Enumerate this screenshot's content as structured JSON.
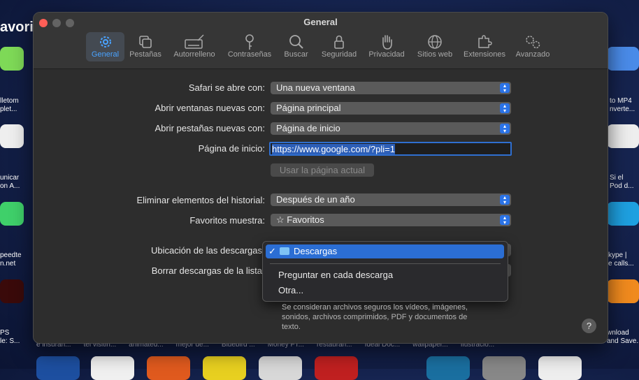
{
  "window": {
    "title": "General"
  },
  "tabs": [
    {
      "label": "General",
      "icon": "gear-icon"
    },
    {
      "label": "Pestañas",
      "icon": "tabs-icon"
    },
    {
      "label": "Autorrelleno",
      "icon": "pencil-keyboard-icon"
    },
    {
      "label": "Contraseñas",
      "icon": "key-icon"
    },
    {
      "label": "Buscar",
      "icon": "magnifier-icon"
    },
    {
      "label": "Seguridad",
      "icon": "lock-icon"
    },
    {
      "label": "Privacidad",
      "icon": "hand-icon"
    },
    {
      "label": "Sitios web",
      "icon": "globe-icon"
    },
    {
      "label": "Extensiones",
      "icon": "puzzle-icon"
    },
    {
      "label": "Avanzado",
      "icon": "gears-icon"
    }
  ],
  "settings": {
    "safari_opens_label": "Safari se abre con:",
    "safari_opens_value": "Una nueva ventana",
    "new_windows_label": "Abrir ventanas nuevas con:",
    "new_windows_value": "Página principal",
    "new_tabs_label": "Abrir pestañas nuevas con:",
    "new_tabs_value": "Página de inicio",
    "homepage_label": "Página de inicio:",
    "homepage_value": "https://www.google.com/?pli=1",
    "use_current_button": "Usar la página actual",
    "history_label": "Eliminar elementos del historial:",
    "history_value": "Después de un año",
    "favorites_label": "Favoritos muestra:",
    "favorites_value": "☆ Favoritos",
    "downloads_location_label": "Ubicación de las descargas",
    "clear_downloads_label": "Borrar descargas de la lista",
    "safe_files_note": "Se consideran archivos seguros los vídeos, imágenes, sonidos, archivos comprimidos, PDF y documentos de texto."
  },
  "downloads_menu": {
    "checkmark": "✓",
    "selected": "Descargas",
    "options": [
      "Preguntar en cada descarga",
      "Otra..."
    ]
  },
  "help": "?",
  "background": {
    "title_fragment": "avorito",
    "left_items": [
      "lletom\nplet...",
      "unicar\non A...",
      "peedte\nn.net",
      "PS\nle: S..."
    ],
    "right_items": [
      "to MP4\nnverte...",
      "Si el\nPod d...",
      "kype |\ne calls...",
      "wnload\nand Save..."
    ],
    "bottom_items": [
      "e insuran...",
      "tel visitin...",
      "animated...",
      "mejor de...",
      "Bluebird ...",
      "Money FT...",
      "restauran...",
      "Ideal Doc...",
      "wallpaper...",
      "Ilustracio..."
    ]
  },
  "colors": {
    "accent": "#2b73e6",
    "active_tab": "#4aa3ff",
    "window_bg": "#2d2d2d"
  }
}
